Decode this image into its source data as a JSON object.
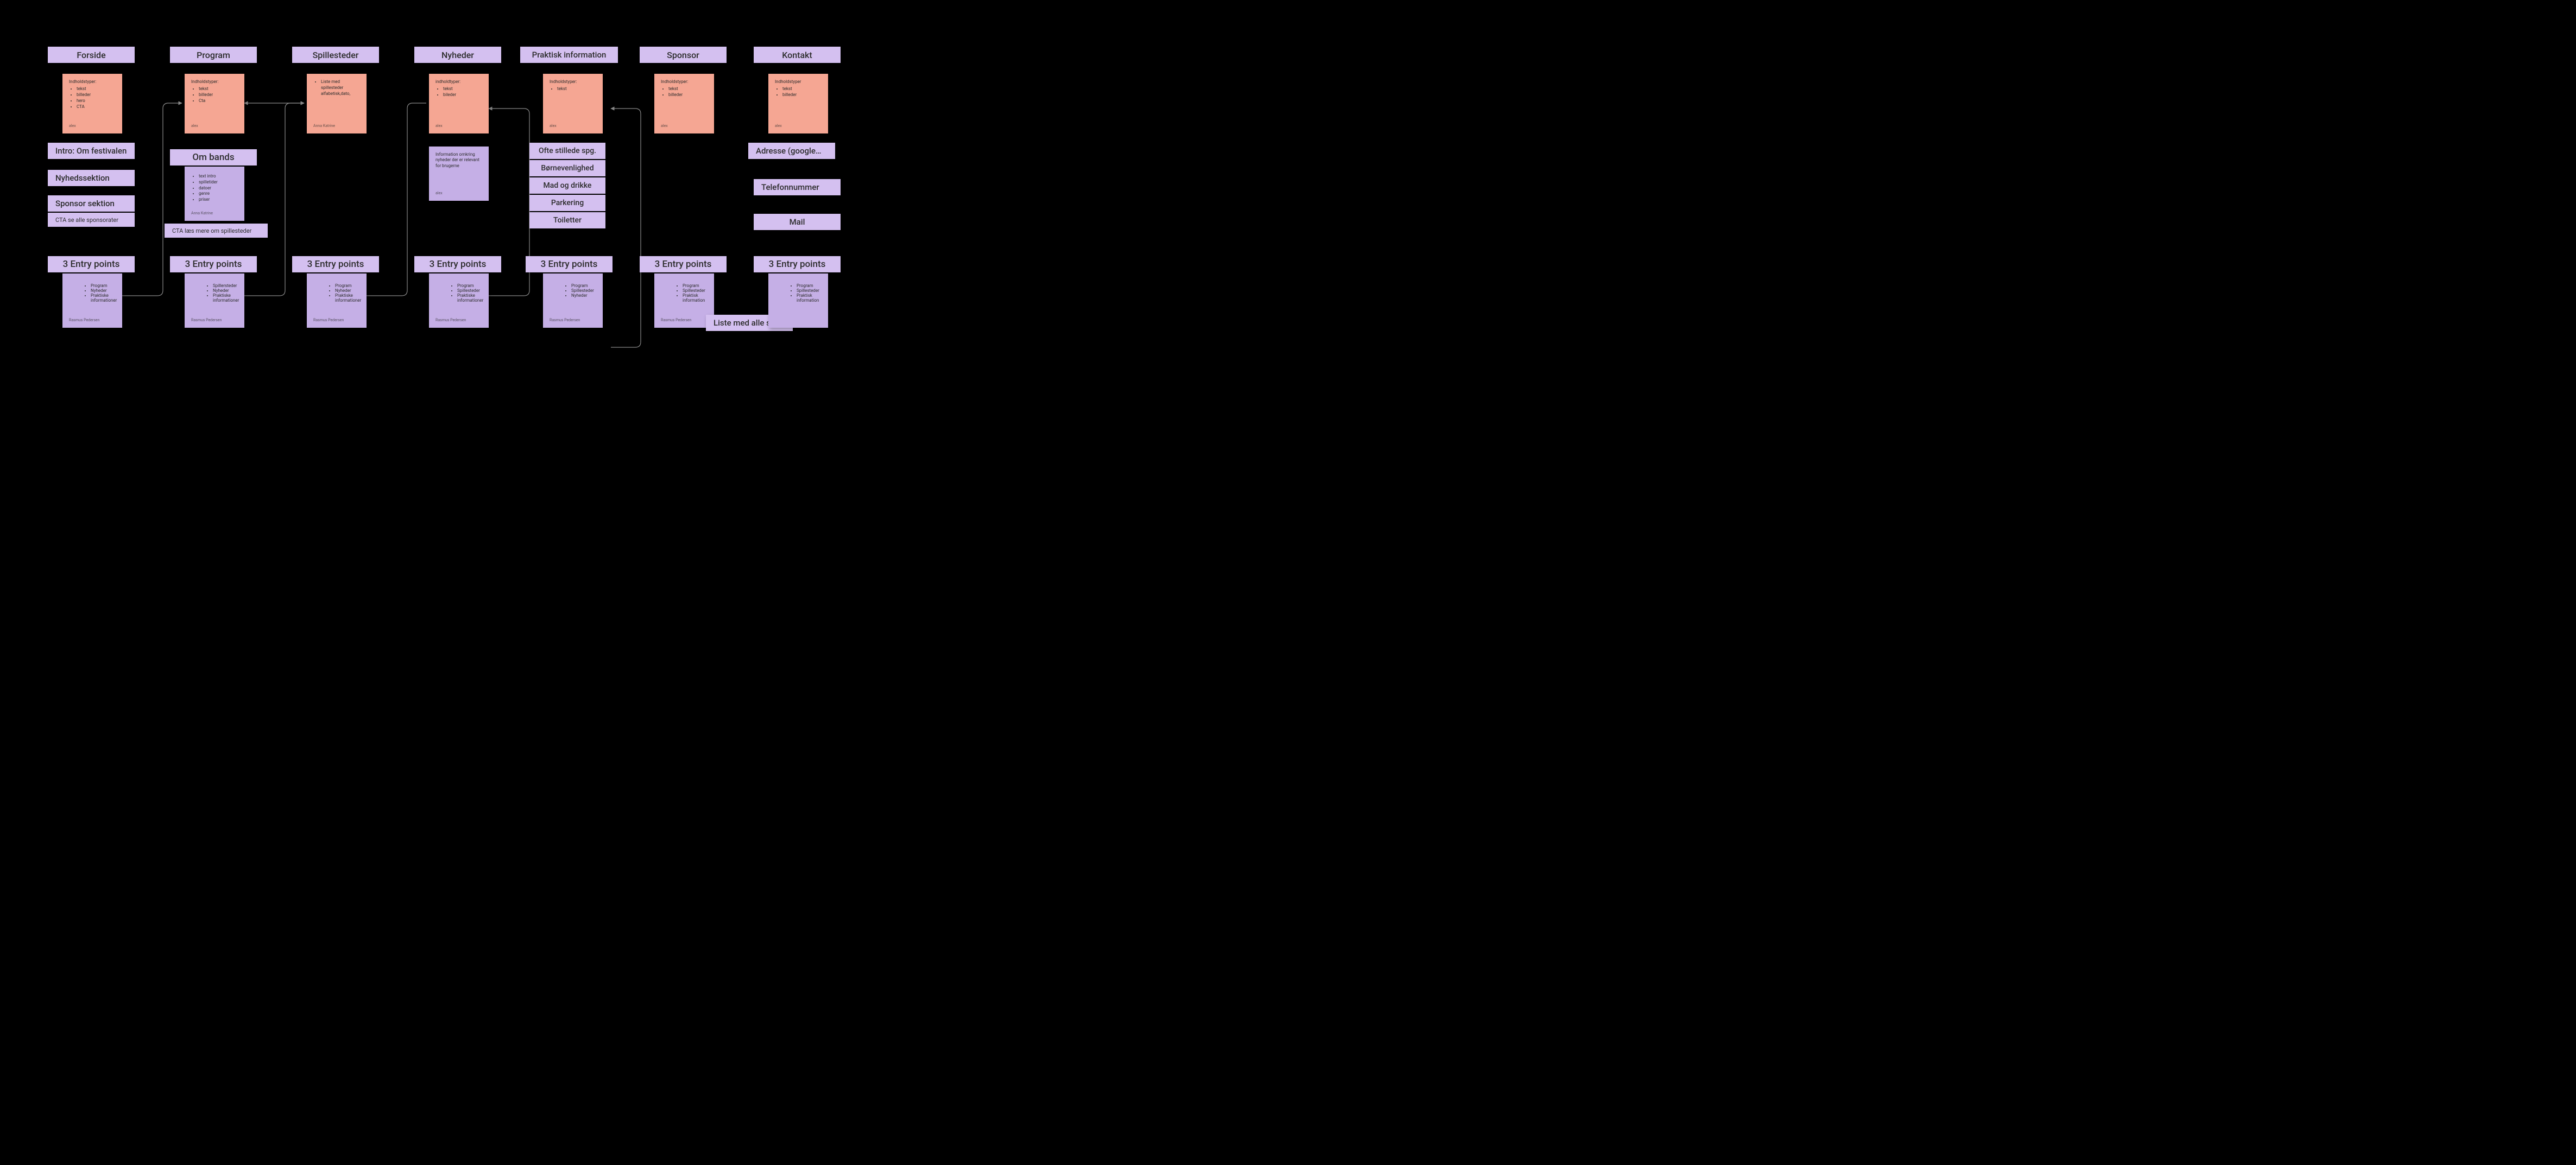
{
  "columns": [
    {
      "key": "forside",
      "header": "Forside",
      "card": {
        "title": "Indholdstyper:",
        "items": [
          "tekst",
          "billeder",
          "hero",
          "CTA"
        ],
        "author": "alex"
      },
      "sections": [
        {
          "type": "pill",
          "label": "Intro: Om festivalen"
        },
        {
          "type": "pill",
          "label": "Nyhedssektion"
        },
        {
          "type": "pill",
          "label": "Sponsor sektion"
        },
        {
          "type": "sub",
          "label": "CTA se alle sponsorater"
        }
      ],
      "entry": {
        "header": "3 Entry points",
        "items": [
          "Program",
          "Nyheder",
          "Praktiske informationer"
        ],
        "author": "Rasmus Pedersen"
      }
    },
    {
      "key": "program",
      "header": "Program",
      "card": {
        "title": "Indholdstyper:",
        "items": [
          "tekst",
          "billeder",
          "Cta"
        ],
        "author": "alex"
      },
      "ombands": {
        "header": "Om bands",
        "items": [
          "text intro",
          "spilletider",
          "datoer",
          "genre",
          "priser"
        ],
        "author": "Anna Katrine"
      },
      "cta": "CTA læs mere om spillesteder",
      "entry": {
        "header": "3 Entry points",
        "items": [
          "Spillersteder",
          "Nyheder",
          "Praktiske informationer"
        ],
        "author": "Rasmus Pedersen"
      }
    },
    {
      "key": "spillesteder",
      "header": "Spillesteder",
      "card": {
        "title": "",
        "items": [
          "Liste med spillesteder alfabetisk,dato,"
        ],
        "author": "Anna Katrine"
      },
      "entry": {
        "header": "3 Entry points",
        "items": [
          "Program",
          "Nyheder",
          "Praktiske informationer"
        ],
        "author": "Rasmus Pedersen"
      }
    },
    {
      "key": "nyheder",
      "header": "Nyheder",
      "card": {
        "title": "indholdtyper:",
        "items": [
          "tekst",
          "bileder"
        ],
        "author": "alex"
      },
      "infocard": {
        "text": "Information omkring nyheder der er relevant for brugerne",
        "author": "alex"
      },
      "entry": {
        "header": "3 Entry points",
        "items": [
          "Program",
          "Spillesteder",
          "Praktiske informationer"
        ],
        "author": "Rasmus Pedersen"
      }
    },
    {
      "key": "praktisk",
      "header": "Praktisk information",
      "card": {
        "title": "Indholdstyper:",
        "items": [
          "tekst"
        ],
        "author": "alex"
      },
      "sections": [
        {
          "type": "narrow",
          "label": "Ofte stillede spg."
        },
        {
          "type": "narrow",
          "label": "Børnevenlighed"
        },
        {
          "type": "narrow",
          "label": "Mad og drikke"
        },
        {
          "type": "narrow",
          "label": "Parkering"
        },
        {
          "type": "narrow",
          "label": "Toiletter"
        }
      ],
      "entry": {
        "header": "3 Entry points",
        "items": [
          "Program",
          "Spillesteder",
          "Nyheder"
        ],
        "author": "Rasmus Pedersen"
      }
    },
    {
      "key": "sponsor",
      "header": "Sponsor",
      "card": {
        "title": "Indholdstyper:",
        "items": [
          "tekst",
          "billeder"
        ],
        "author": "alex"
      },
      "entry": {
        "header": "3 Entry points",
        "items": [
          "Program",
          "Spillesteder",
          "Praktisk information"
        ],
        "author": "Rasmus Pedersen"
      },
      "liste": "Liste med alle spo…"
    },
    {
      "key": "kontakt",
      "header": "Kontakt",
      "card": {
        "title": "Indholdstyper",
        "items": [
          "tekst",
          "billeder"
        ],
        "author": "alex"
      },
      "sections": [
        {
          "type": "pill",
          "label": "Adresse (google…"
        },
        {
          "type": "pill",
          "label": "Telefonnummer"
        },
        {
          "type": "pill",
          "label": "Mail"
        }
      ],
      "entry": {
        "header": "3 Entry points",
        "items": [
          "Program",
          "Spillesteder",
          "Praktisk information"
        ],
        "author": ""
      }
    }
  ]
}
